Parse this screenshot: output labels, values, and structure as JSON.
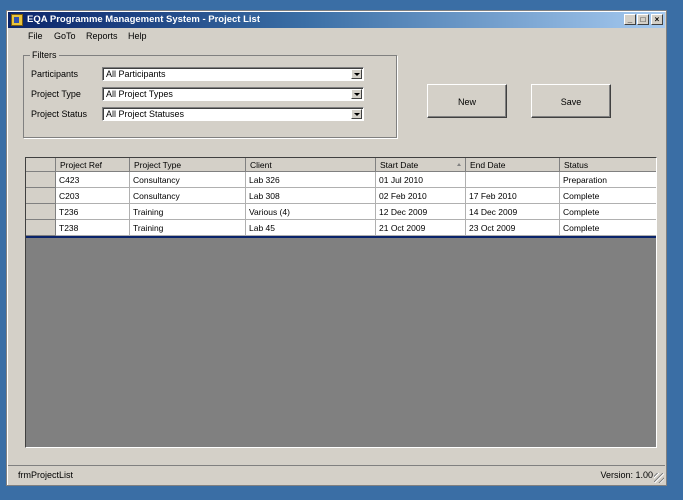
{
  "window": {
    "title": "EQA Programme Management System - Project List"
  },
  "menu": {
    "items": [
      "File",
      "GoTo",
      "Reports",
      "Help"
    ]
  },
  "filters": {
    "legend": "Filters",
    "participants": {
      "label": "Participants",
      "value": "All Participants"
    },
    "project_type": {
      "label": "Project Type",
      "value": "All Project Types"
    },
    "project_status": {
      "label": "Project Status",
      "value": "All Project Statuses"
    }
  },
  "buttons": {
    "new": "New",
    "save": "Save"
  },
  "grid": {
    "columns": [
      "Project Ref",
      "Project Type",
      "Client",
      "Start Date",
      "End Date",
      "Status"
    ],
    "sorted_column": "Start Date",
    "rows": [
      [
        "C423",
        "Consultancy",
        "Lab 326",
        "01 Jul 2010",
        "",
        "Preparation"
      ],
      [
        "C203",
        "Consultancy",
        "Lab 308",
        "02 Feb 2010",
        "17 Feb 2010",
        "Complete"
      ],
      [
        "T236",
        "Training",
        "Various (4)",
        "12 Dec 2009",
        "14 Dec 2009",
        "Complete"
      ],
      [
        "T238",
        "Training",
        "Lab 45",
        "21 Oct 2009",
        "23 Oct 2009",
        "Complete"
      ]
    ]
  },
  "status": {
    "form_name": "frmProjectList",
    "version": "Version: 1.00"
  }
}
